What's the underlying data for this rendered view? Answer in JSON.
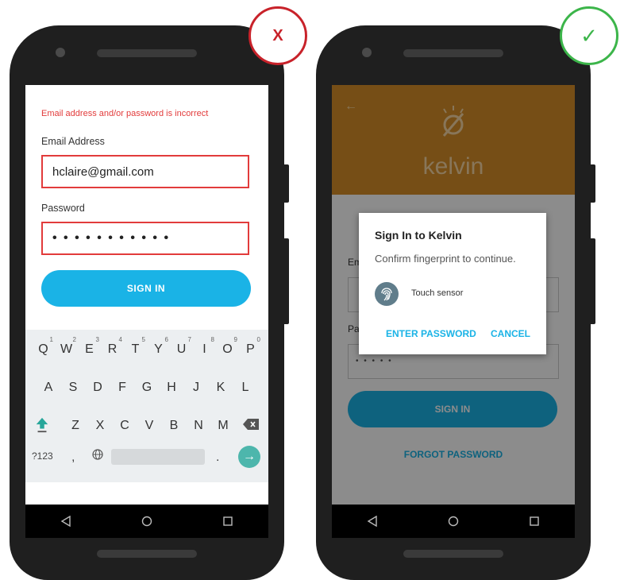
{
  "bad_badge": {
    "symbol": "X",
    "color": "#c8222a"
  },
  "good_badge": {
    "symbol": "✓",
    "color": "#3cb54a"
  },
  "left_screen": {
    "error_message": "Email address and/or password is incorrect",
    "email_label": "Email Address",
    "email_value": "hclaire@gmail.com",
    "password_label": "Password",
    "password_value": "• • • • • • • • • • •",
    "sign_in_label": "SIGN IN",
    "keyboard": {
      "row1": [
        {
          "k": "Q",
          "n": "1"
        },
        {
          "k": "W",
          "n": "2"
        },
        {
          "k": "E",
          "n": "3"
        },
        {
          "k": "R",
          "n": "4"
        },
        {
          "k": "T",
          "n": "5"
        },
        {
          "k": "Y",
          "n": "6"
        },
        {
          "k": "U",
          "n": "7"
        },
        {
          "k": "I",
          "n": "8"
        },
        {
          "k": "O",
          "n": "9"
        },
        {
          "k": "P",
          "n": "0"
        }
      ],
      "row2": [
        "A",
        "S",
        "D",
        "F",
        "G",
        "H",
        "J",
        "K",
        "L"
      ],
      "row3": [
        "Z",
        "X",
        "C",
        "V",
        "B",
        "N",
        "M"
      ],
      "symbols_key": "?123",
      "comma_key": ",",
      "period_key": "."
    }
  },
  "right_screen": {
    "app_name": "kelvin",
    "email_label_partial": "Em",
    "password_label_partial": "Pa",
    "password_dots": "• • • • •",
    "sign_in_label": "SIGN IN",
    "forgot_label": "FORGOT PASSWORD",
    "dialog": {
      "title": "Sign In to Kelvin",
      "message": "Confirm fingerprint to continue.",
      "sensor_label": "Touch sensor",
      "enter_password": "ENTER PASSWORD",
      "cancel": "CANCEL"
    }
  },
  "colors": {
    "error": "#e23b3b",
    "primary": "#1ab3e6",
    "brand_orange": "#d78f28",
    "enter_key": "#4db6ac"
  },
  "nav_icons": [
    "back-triangle-icon",
    "home-circle-icon",
    "recents-square-icon"
  ]
}
